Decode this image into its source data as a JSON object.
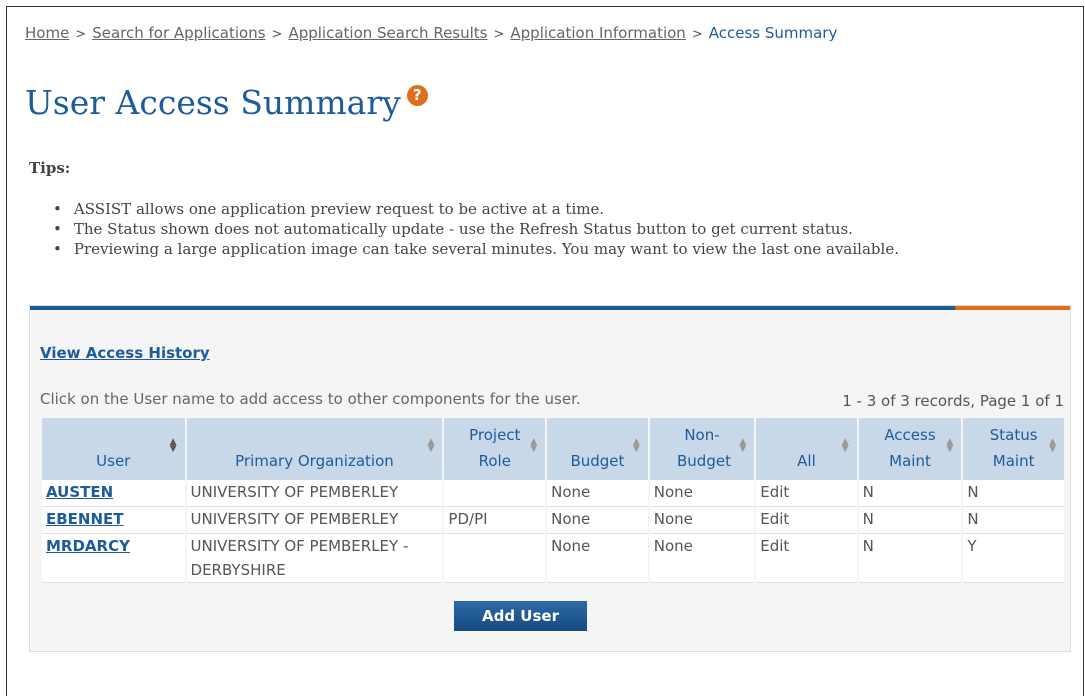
{
  "breadcrumb": {
    "items": [
      "Home",
      "Search for Applications",
      "Application Search Results",
      "Application Information"
    ],
    "current": "Access Summary",
    "separator": ">"
  },
  "page": {
    "title": "User Access Summary",
    "help_icon": "?"
  },
  "tips": {
    "title": "Tips:",
    "items": [
      "ASSIST allows one application preview request to be active at a time.",
      "The Status shown does not automatically update - use the Refresh Status button to get current status.",
      "Previewing a large application image can take several minutes.  You may want to view the last one available."
    ]
  },
  "panel": {
    "history_link": "View Access History",
    "instruction": "Click on the User name to add access to other components for the user.",
    "records": "1 - 3 of 3 records, Page 1 of 1",
    "add_button": "Add User"
  },
  "table": {
    "columns": [
      "User",
      "Primary Organization",
      "Project Role",
      "Budget",
      "Non-Budget",
      "All",
      "Access Maint",
      "Status Maint"
    ],
    "rows": [
      [
        "AUSTEN",
        "UNIVERSITY OF PEMBERLEY",
        "",
        "None",
        "None",
        "Edit",
        "N",
        "N"
      ],
      [
        "EBENNET",
        "UNIVERSITY OF PEMBERLEY",
        "PD/PI",
        "None",
        "None",
        "Edit",
        "N",
        "N"
      ],
      [
        "MRDARCY",
        "UNIVERSITY OF PEMBERLEY - DERBYSHIRE",
        "",
        "None",
        "None",
        "Edit",
        "N",
        "Y"
      ]
    ]
  },
  "colors": {
    "accent": "#1e5b9a",
    "orange": "#e06f1d",
    "header_bg": "#c8d8e8"
  }
}
